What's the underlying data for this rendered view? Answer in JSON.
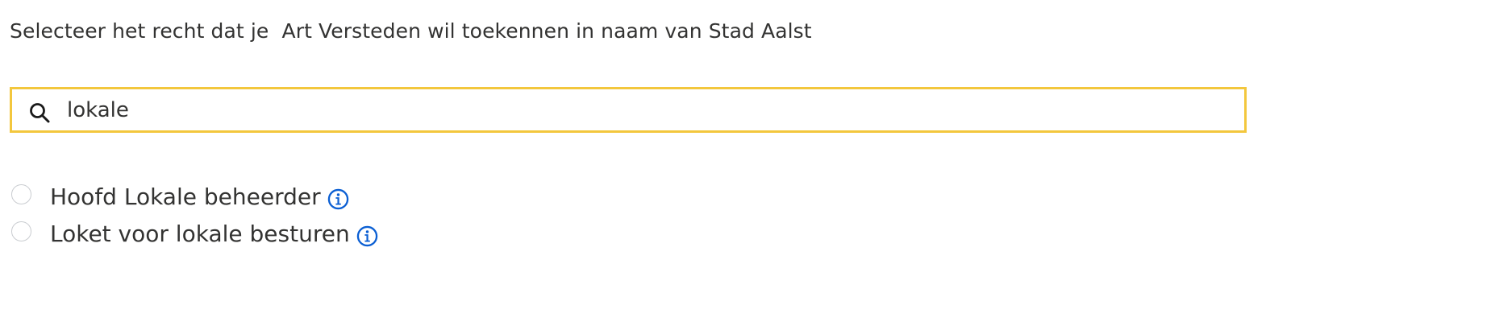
{
  "instruction": {
    "text": "Selecteer het recht dat je  Art Versteden wil toekennen in naam van Stad Aalst"
  },
  "search": {
    "value": "lokale",
    "icon": "search-icon",
    "border_color": "#f3c73d"
  },
  "options": [
    {
      "label": "Hoofd Lokale beheerder",
      "selected": false,
      "info_icon": "info-icon"
    },
    {
      "label": "Loket voor lokale besturen",
      "selected": false,
      "info_icon": "info-icon"
    }
  ],
  "colors": {
    "text": "#333332",
    "accent_blue": "#0b5fd3",
    "focus_yellow": "#f3c73d"
  }
}
